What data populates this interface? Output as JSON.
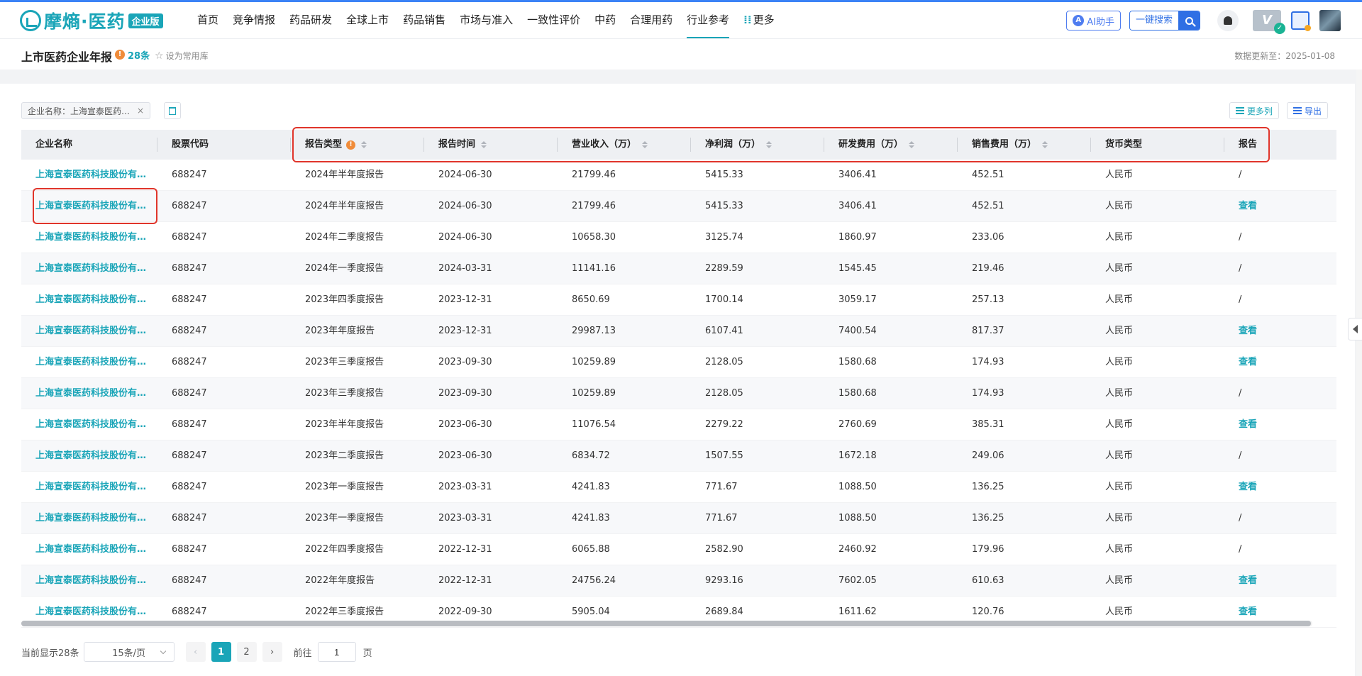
{
  "brand": {
    "name": "摩熵·医药",
    "edition": "企业版"
  },
  "nav": [
    "首页",
    "竞争情报",
    "药品研发",
    "全球上市",
    "药品销售",
    "市场与准入",
    "一致性评价",
    "中药",
    "合理用药",
    "行业参考",
    "更多"
  ],
  "nav_active_index": 9,
  "topright": {
    "ai_label": "AI助手",
    "ai_icon": "A",
    "search_label": "一键搜索",
    "vip_label": "V"
  },
  "page": {
    "title": "上市医药企业年报",
    "info_icon": "!",
    "count": "28条",
    "favorite": "设为常用库",
    "update": "数据更新至：2025-01-08"
  },
  "filter": {
    "chip": "企业名称：上海宣泰医药…",
    "close": "×"
  },
  "tools": {
    "more_cols": "更多列",
    "export": "导出"
  },
  "table": {
    "headers": [
      "企业名称",
      "股票代码",
      "报告类型",
      "报告时间",
      "营业收入（万）",
      "净利润（万）",
      "研发费用（万）",
      "销售费用（万）",
      "货币类型",
      "报告"
    ],
    "rows": [
      [
        "上海宣泰医药科技股份有…",
        "688247",
        "2024年半年度报告",
        "2024-06-30",
        "21799.46",
        "5415.33",
        "3406.41",
        "452.51",
        "人民币",
        "/"
      ],
      [
        "上海宣泰医药科技股份有…",
        "688247",
        "2024年半年度报告",
        "2024-06-30",
        "21799.46",
        "5415.33",
        "3406.41",
        "452.51",
        "人民币",
        "查看"
      ],
      [
        "上海宣泰医药科技股份有…",
        "688247",
        "2024年二季度报告",
        "2024-06-30",
        "10658.30",
        "3125.74",
        "1860.97",
        "233.06",
        "人民币",
        "/"
      ],
      [
        "上海宣泰医药科技股份有…",
        "688247",
        "2024年一季度报告",
        "2024-03-31",
        "11141.16",
        "2289.59",
        "1545.45",
        "219.46",
        "人民币",
        "/"
      ],
      [
        "上海宣泰医药科技股份有…",
        "688247",
        "2023年四季度报告",
        "2023-12-31",
        "8650.69",
        "1700.14",
        "3059.17",
        "257.13",
        "人民币",
        "/"
      ],
      [
        "上海宣泰医药科技股份有…",
        "688247",
        "2023年年度报告",
        "2023-12-31",
        "29987.13",
        "6107.41",
        "7400.54",
        "817.37",
        "人民币",
        "查看"
      ],
      [
        "上海宣泰医药科技股份有…",
        "688247",
        "2023年三季度报告",
        "2023-09-30",
        "10259.89",
        "2128.05",
        "1580.68",
        "174.93",
        "人民币",
        "查看"
      ],
      [
        "上海宣泰医药科技股份有…",
        "688247",
        "2023年三季度报告",
        "2023-09-30",
        "10259.89",
        "2128.05",
        "1580.68",
        "174.93",
        "人民币",
        "/"
      ],
      [
        "上海宣泰医药科技股份有…",
        "688247",
        "2023年半年度报告",
        "2023-06-30",
        "11076.54",
        "2279.22",
        "2760.69",
        "385.31",
        "人民币",
        "查看"
      ],
      [
        "上海宣泰医药科技股份有…",
        "688247",
        "2023年二季度报告",
        "2023-06-30",
        "6834.72",
        "1507.55",
        "1672.18",
        "249.06",
        "人民币",
        "/"
      ],
      [
        "上海宣泰医药科技股份有…",
        "688247",
        "2023年一季度报告",
        "2023-03-31",
        "4241.83",
        "771.67",
        "1088.50",
        "136.25",
        "人民币",
        "查看"
      ],
      [
        "上海宣泰医药科技股份有…",
        "688247",
        "2023年一季度报告",
        "2023-03-31",
        "4241.83",
        "771.67",
        "1088.50",
        "136.25",
        "人民币",
        "/"
      ],
      [
        "上海宣泰医药科技股份有…",
        "688247",
        "2022年四季度报告",
        "2022-12-31",
        "6065.88",
        "2582.90",
        "2460.92",
        "179.96",
        "人民币",
        "/"
      ],
      [
        "上海宣泰医药科技股份有…",
        "688247",
        "2022年年度报告",
        "2022-12-31",
        "24756.24",
        "9293.16",
        "7602.05",
        "610.63",
        "人民币",
        "查看"
      ],
      [
        "上海宣泰医药科技股份有…",
        "688247",
        "2022年三季度报告",
        "2022-09-30",
        "5905.04",
        "2689.84",
        "1611.62",
        "120.76",
        "人民币",
        "查看"
      ]
    ]
  },
  "pagination": {
    "total": "当前显示28条",
    "page_size": "15条/页",
    "prev": "‹",
    "next": "›",
    "pages": [
      "1",
      "2"
    ],
    "current": "1",
    "goto": "前往",
    "goto_value": "1",
    "page_unit": "页"
  },
  "colors": {
    "accent": "#1aa5b8",
    "blue": "#2f6fe4",
    "annotation": "#e0352b"
  }
}
